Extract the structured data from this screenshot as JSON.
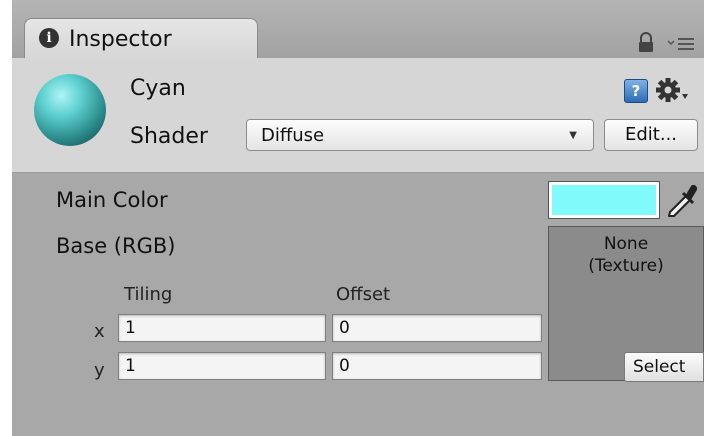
{
  "tab": {
    "title": "Inspector",
    "info_icon": "i"
  },
  "header": {
    "material_name": "Cyan",
    "shader_label": "Shader",
    "shader_value": "Diffuse",
    "edit_label": "Edit...",
    "help_icon": "?"
  },
  "properties": {
    "main_color_label": "Main Color",
    "main_color_value": "#80fafa",
    "base_label": "Base (RGB)",
    "texture_none": "None",
    "texture_sub": "(Texture)",
    "select_label": "Select",
    "tiling_label": "Tiling",
    "offset_label": "Offset",
    "x_label": "x",
    "y_label": "y",
    "tiling_x": "1",
    "tiling_y": "1",
    "offset_x": "0",
    "offset_y": "0"
  },
  "icons": {
    "info": "info-icon",
    "lock": "lock-icon",
    "menu": "menu-icon",
    "help": "help-icon",
    "gear": "gear-icon",
    "eyedropper": "eyedropper-icon",
    "sphere": "material-preview-sphere"
  }
}
